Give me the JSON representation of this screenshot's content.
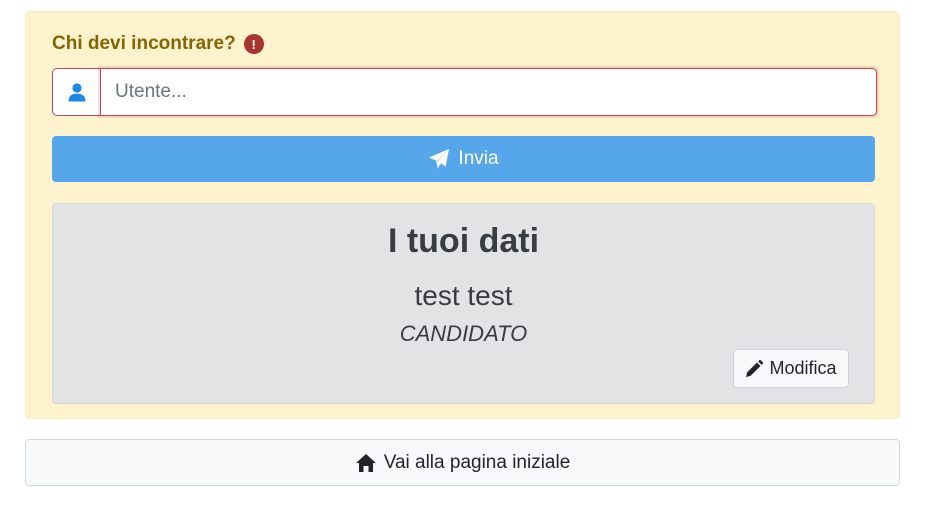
{
  "question": {
    "label": "Chi devi incontrare?",
    "alert_icon": "exclamation-circle-icon",
    "alert_symbol": "!"
  },
  "search": {
    "icon": "user-icon",
    "placeholder": "Utente...",
    "value": ""
  },
  "send": {
    "icon": "paper-plane-icon",
    "label": "Invia"
  },
  "profile": {
    "title": "I tuoi dati",
    "name": "test test",
    "role": "CANDIDATO",
    "edit_icon": "pencil-icon",
    "edit_label": "Modifica"
  },
  "home": {
    "icon": "home-icon",
    "label": "Vai alla pagina iniziale"
  },
  "colors": {
    "panel_bg": "#fff3cd",
    "question_text": "#856404",
    "alert_red": "#a8342e",
    "primary_button": "#56a6ec",
    "user_icon": "#1e88e5",
    "card_bg": "#e2e3e5"
  }
}
